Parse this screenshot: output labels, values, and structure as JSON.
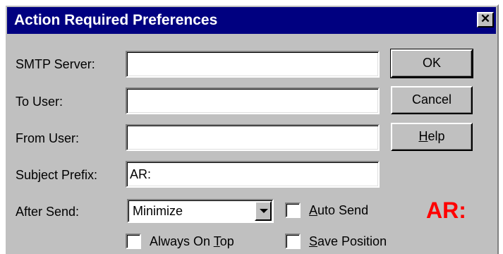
{
  "window": {
    "title": "Action Required Preferences",
    "close_glyph": "✕"
  },
  "form": {
    "smtp_server": {
      "label": "SMTP Server:",
      "value": ""
    },
    "to_user": {
      "label": "To User:",
      "value": ""
    },
    "from_user": {
      "label": "From User:",
      "value": ""
    },
    "subject_prefix": {
      "label": "Subject Prefix:",
      "value": "AR:"
    },
    "after_send": {
      "label": "After Send:",
      "selected": "Minimize"
    }
  },
  "checkboxes": {
    "auto_send": {
      "accel": "A",
      "rest": "uto Send",
      "checked": false
    },
    "always_on_top": {
      "pre": "Always On ",
      "accel": "T",
      "rest": "op",
      "checked": false
    },
    "save_position": {
      "accel": "S",
      "rest": "ave Position",
      "checked": false
    }
  },
  "buttons": {
    "ok": "OK",
    "cancel": "Cancel",
    "help": {
      "accel": "H",
      "rest": "elp"
    }
  },
  "logo": {
    "text": "AR:",
    "color": "#ff0000"
  },
  "colors": {
    "titlebar": "#000080",
    "face": "#c0c0c0"
  }
}
